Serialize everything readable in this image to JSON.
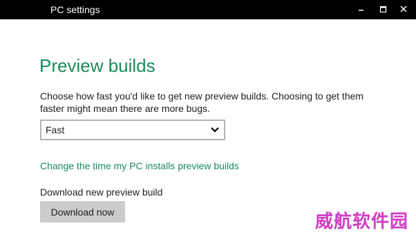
{
  "window": {
    "title": "PC settings",
    "controls": [
      "minimize-icon",
      "maximize-icon",
      "close-icon"
    ]
  },
  "main": {
    "title": "Preview builds",
    "description": "Choose how fast you'd like to get new preview builds. Choosing to get them faster might mean there are more bugs.",
    "speed_select": {
      "value": "Fast",
      "icon": "chevron-down-icon"
    },
    "change_time_link": "Change the time my PC installs preview builds",
    "download_label": "Download new preview build",
    "download_button": "Download now"
  },
  "watermark": "威航软件园",
  "colors": {
    "accent": "#1a8a5a",
    "titlebar": "#000000",
    "button_bg": "#cccccc",
    "watermark": "#d13cc4"
  }
}
